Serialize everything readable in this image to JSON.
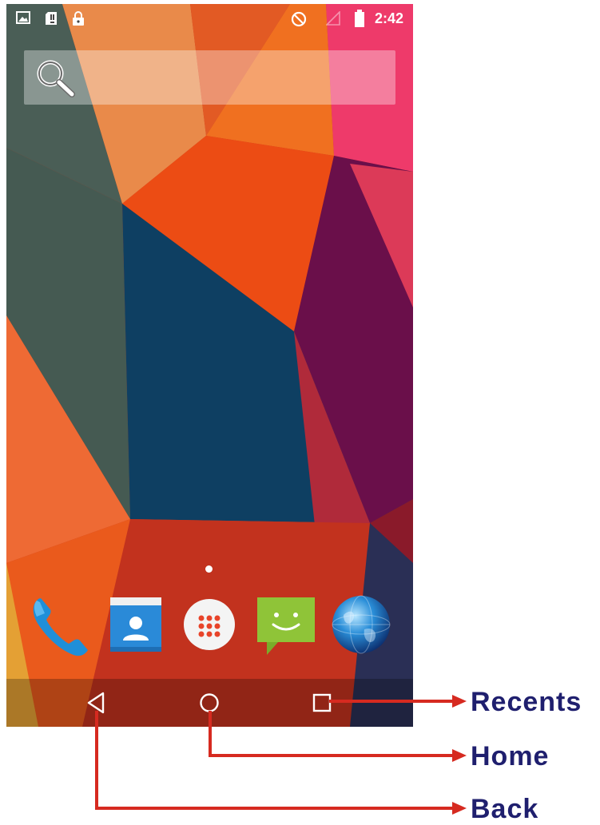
{
  "status_bar": {
    "time": "2:42",
    "icons": [
      "image-icon",
      "sd-card-icon",
      "lock-icon",
      "do-not-disturb-icon",
      "signal-icon",
      "battery-icon"
    ]
  },
  "search": {
    "icon": "search-icon"
  },
  "dock": {
    "items": [
      {
        "name": "phone-app",
        "icon": "phone-icon"
      },
      {
        "name": "contacts-app",
        "icon": "contacts-icon"
      },
      {
        "name": "app-drawer",
        "icon": "app-drawer-icon"
      },
      {
        "name": "messaging-app",
        "icon": "messaging-icon"
      },
      {
        "name": "browser-app",
        "icon": "globe-icon"
      }
    ]
  },
  "navigation": {
    "buttons": [
      "back-icon",
      "home-icon",
      "recents-icon"
    ]
  },
  "callouts": {
    "recents": "Recents",
    "home": "Home",
    "back": "Back"
  },
  "colors": {
    "arrow": "#d62a20",
    "label": "#1f1f6e"
  }
}
